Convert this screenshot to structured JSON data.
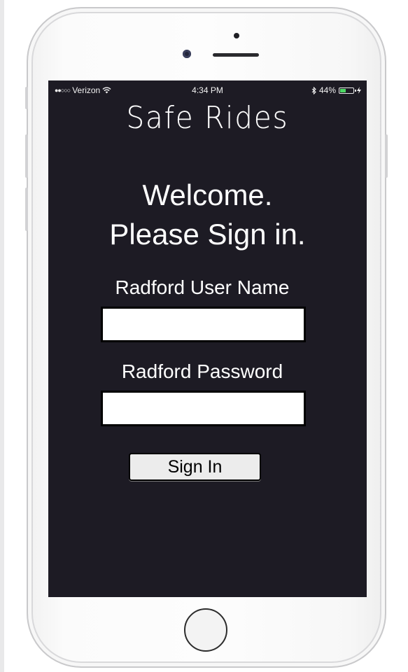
{
  "status_bar": {
    "carrier": "Verizon",
    "time": "4:34 PM",
    "battery_percent": "44%",
    "battery_level": 0.44,
    "battery_color": "#4cd964"
  },
  "app": {
    "title": "Safe Rides",
    "welcome_line1": "Welcome.",
    "welcome_line2": "Please Sign in."
  },
  "form": {
    "username_label": "Radford User Name",
    "username_value": "",
    "password_label": "Radford Password",
    "password_value": "",
    "sign_in_label": "Sign In"
  },
  "colors": {
    "screen_background": "#1d1b24",
    "text": "#ffffff",
    "button_background": "#ececec"
  },
  "icons": {
    "signal": "signal-dots-icon",
    "wifi": "wifi-icon",
    "bluetooth": "bluetooth-icon",
    "battery": "battery-icon",
    "charging": "charging-bolt-icon"
  }
}
